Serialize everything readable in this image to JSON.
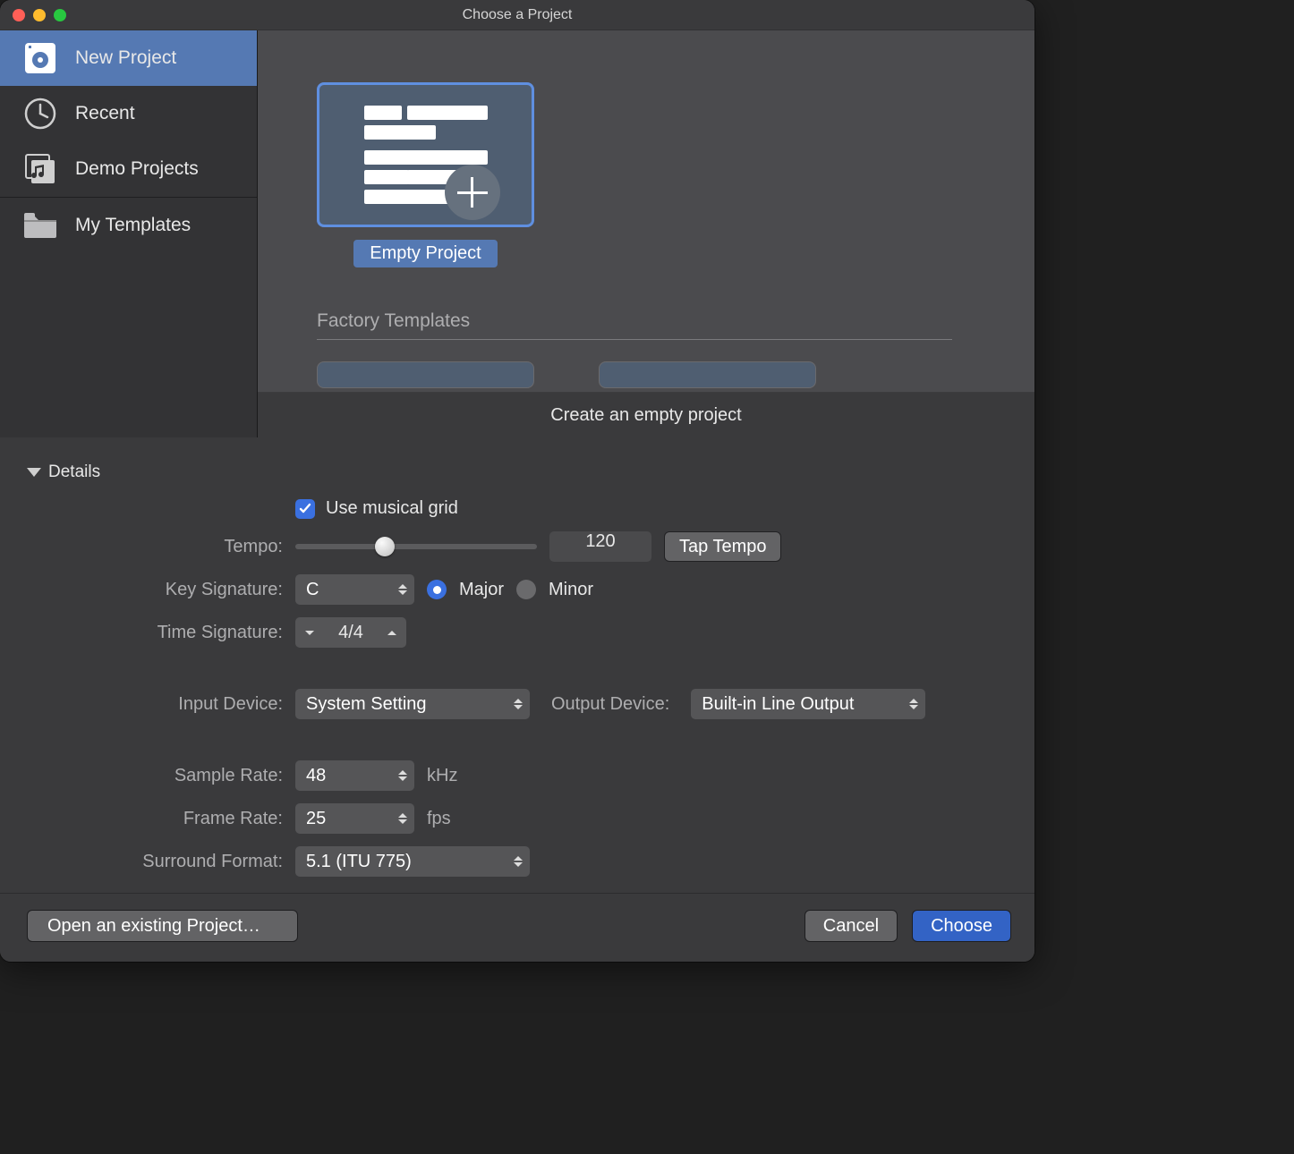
{
  "window": {
    "title": "Choose a Project"
  },
  "sidebar": {
    "items": [
      {
        "label": "New Project",
        "selected": true
      },
      {
        "label": "Recent",
        "selected": false
      },
      {
        "label": "Demo Projects",
        "selected": false
      },
      {
        "label": "My Templates",
        "selected": false
      }
    ]
  },
  "gallery": {
    "selected_card_label": "Empty Project",
    "factory_header": "Factory Templates",
    "description_bar": "Create an empty project"
  },
  "details": {
    "header": "Details",
    "use_musical_grid": {
      "label": "Use musical grid",
      "checked": true
    },
    "tempo": {
      "label": "Tempo:",
      "value": "120",
      "slider_percent": 37,
      "tap_button": "Tap Tempo"
    },
    "key_signature": {
      "label": "Key Signature:",
      "value": "C",
      "major_label": "Major",
      "minor_label": "Minor",
      "mode": "major"
    },
    "time_signature": {
      "label": "Time Signature:",
      "value": "4/4"
    },
    "input_device": {
      "label": "Input Device:",
      "value": "System Setting"
    },
    "output_device": {
      "label": "Output Device:",
      "value": "Built-in Line Output"
    },
    "sample_rate": {
      "label": "Sample Rate:",
      "value": "48",
      "unit": "kHz"
    },
    "frame_rate": {
      "label": "Frame Rate:",
      "value": "25",
      "unit": "fps"
    },
    "surround_format": {
      "label": "Surround Format:",
      "value": "5.1 (ITU 775)"
    }
  },
  "footer": {
    "open_existing": "Open an existing Project…",
    "cancel": "Cancel",
    "choose": "Choose"
  }
}
